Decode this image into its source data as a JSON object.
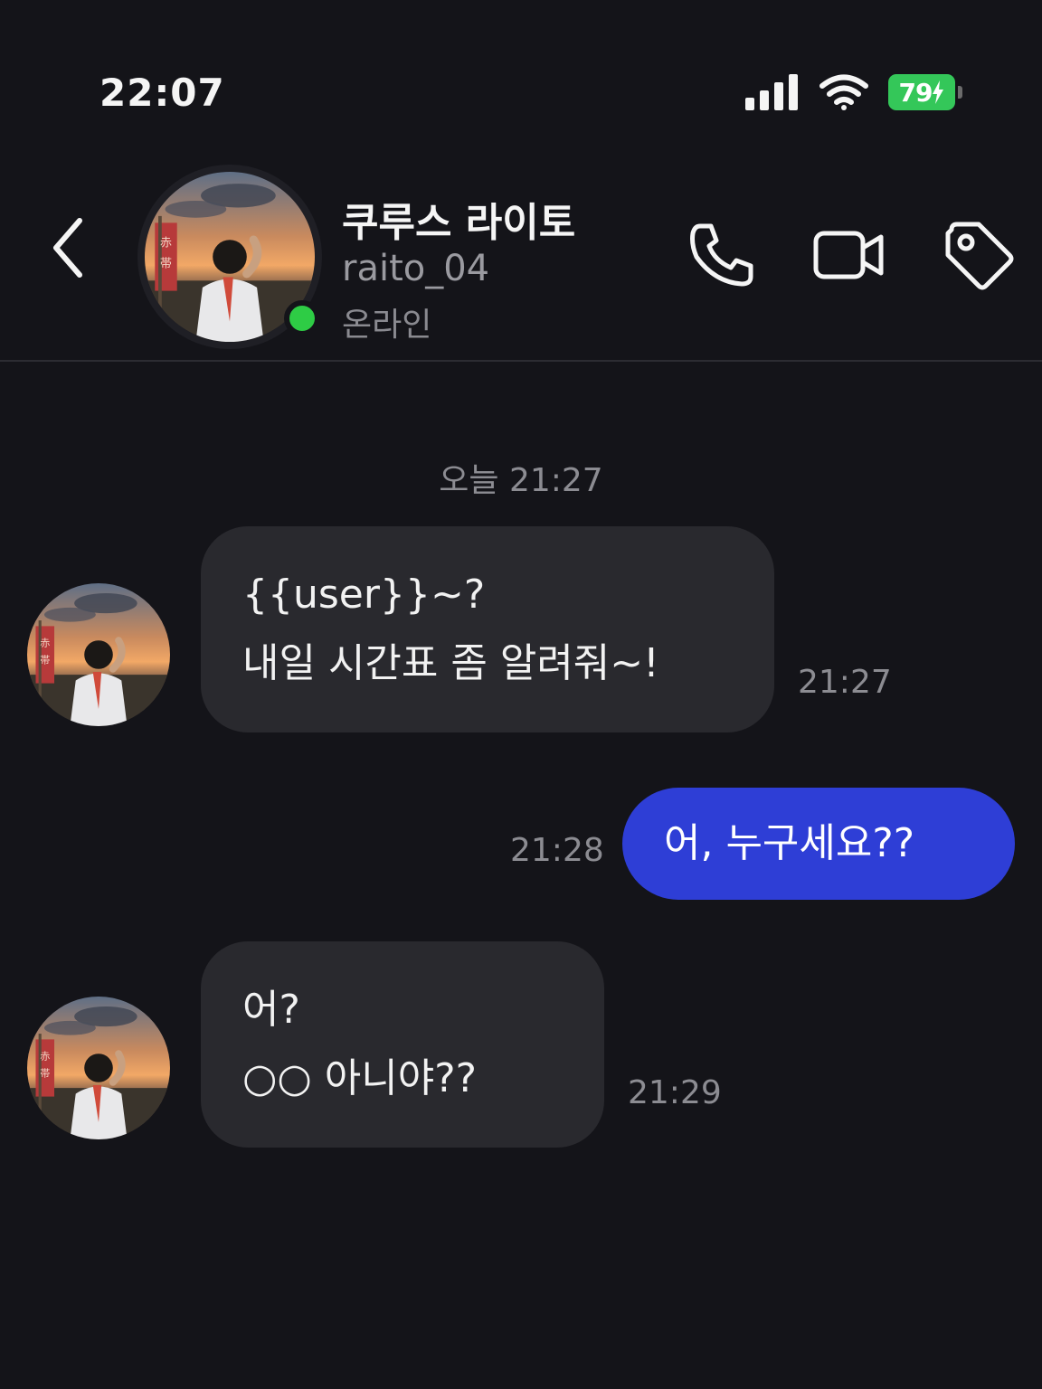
{
  "status_bar": {
    "time": "22:07",
    "battery": "79",
    "icons": [
      "cellular-signal-icon",
      "wifi-icon",
      "battery-charging-icon"
    ],
    "battery_color": "#34c759"
  },
  "header": {
    "name": "쿠루스 라이토",
    "handle": "raito_04",
    "status": "온라인",
    "online_color": "#2ecc45",
    "actions": [
      "phone-icon",
      "video-camera-icon",
      "tag-icon"
    ]
  },
  "chat": {
    "date_divider": "오늘 21:27",
    "messages": [
      {
        "direction": "incoming",
        "lines": [
          "{{user}}~?",
          "내일 시간표 좀 알려줘~!"
        ],
        "time": "21:27"
      },
      {
        "direction": "outgoing",
        "lines": [
          "어, 누구세요??"
        ],
        "time": "21:28"
      },
      {
        "direction": "incoming",
        "lines": [
          "어?",
          "○○ 아니야??"
        ],
        "time": "21:29"
      }
    ],
    "incoming_bubble_color": "#29292e",
    "outgoing_bubble_color": "#2e3ed6"
  }
}
